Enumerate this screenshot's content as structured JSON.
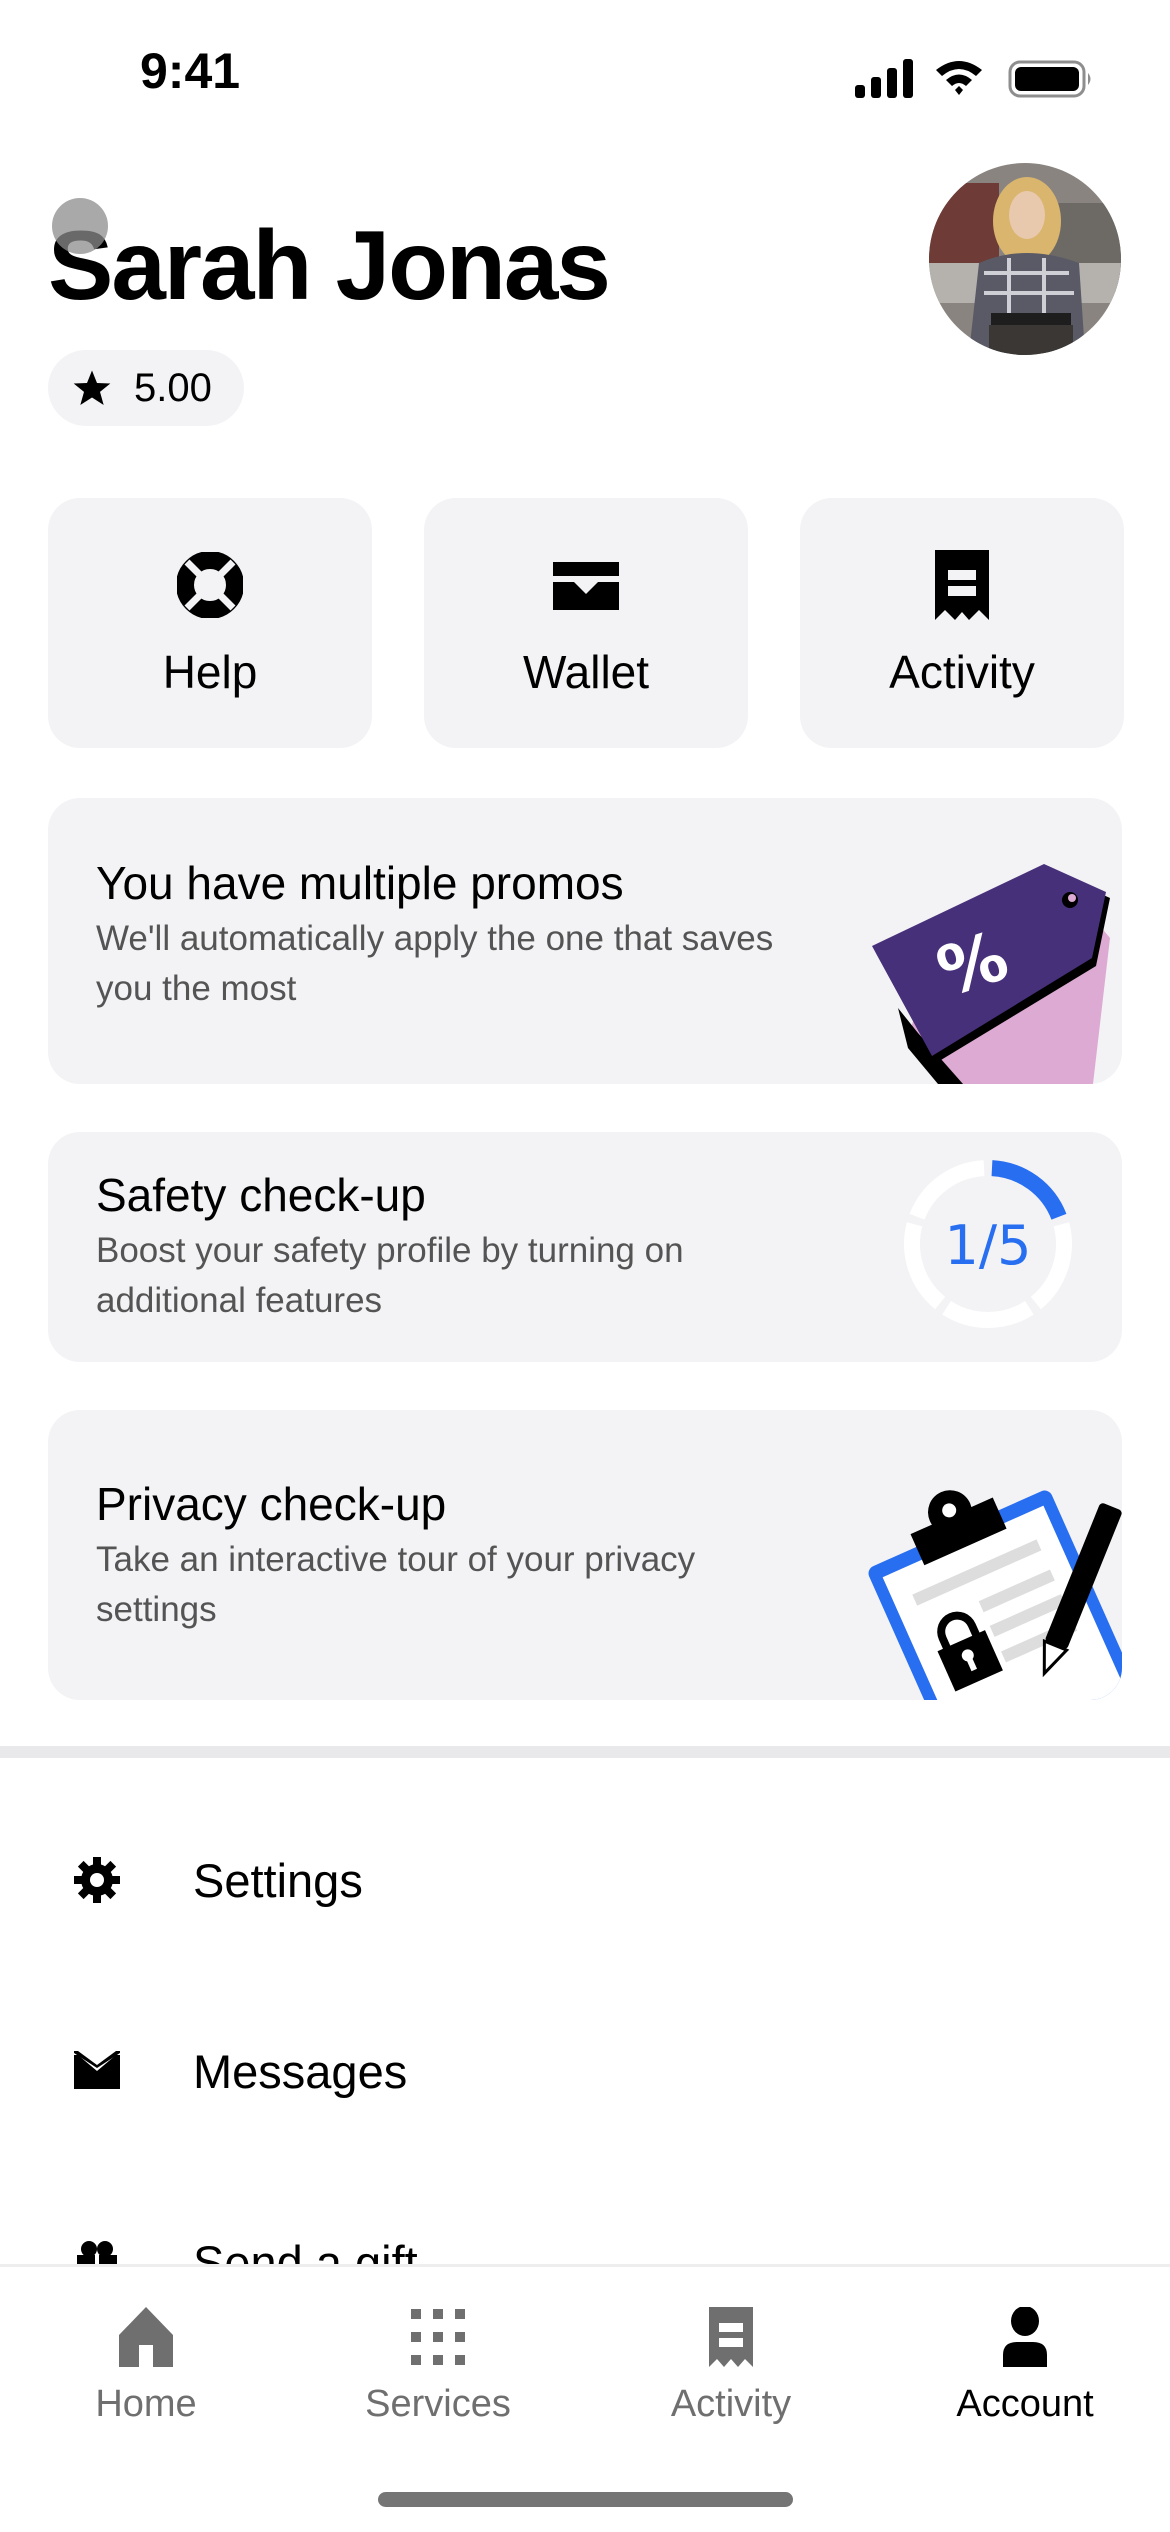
{
  "status_bar": {
    "time": "9:41",
    "icons": [
      "cellular-signal-icon",
      "wifi-icon",
      "battery-icon"
    ]
  },
  "profile": {
    "name": "Sarah Jonas",
    "rating": "5.00",
    "rating_icon": "star-icon",
    "avatar": "profile-photo"
  },
  "quick_actions": [
    {
      "label": "Help",
      "icon": "lifebuoy-icon"
    },
    {
      "label": "Wallet",
      "icon": "wallet-icon"
    },
    {
      "label": "Activity",
      "icon": "receipt-icon"
    }
  ],
  "cards": {
    "promos": {
      "title": "You have multiple promos",
      "subtitle": "We'll automatically apply the one that saves you the most",
      "art": "discount-tag-illustration",
      "art_glyph": "%"
    },
    "safety": {
      "title": "Safety check-up",
      "subtitle": "Boost your safety profile by turning on additional features",
      "progress_label": "1/5",
      "progress_completed": 1,
      "progress_total": 5
    },
    "privacy": {
      "title": "Privacy check-up",
      "subtitle": "Take an interactive tour of your privacy settings",
      "art": "clipboard-lock-illustration"
    }
  },
  "menu": [
    {
      "label": "Settings",
      "icon": "gear-icon"
    },
    {
      "label": "Messages",
      "icon": "envelope-icon"
    },
    {
      "label": "Send a gift",
      "icon": "gift-icon"
    }
  ],
  "tab_bar": {
    "active": "Account",
    "tabs": [
      {
        "label": "Home",
        "icon": "home-icon"
      },
      {
        "label": "Services",
        "icon": "grid-icon"
      },
      {
        "label": "Activity",
        "icon": "receipt-icon"
      },
      {
        "label": "Account",
        "icon": "person-icon"
      }
    ]
  },
  "colors": {
    "card_bg": "#f3f2f5",
    "accent_blue": "#276ef1",
    "promo_purple": "#47307a",
    "promo_pink": "#dcaad2",
    "secondary_text": "#545454",
    "inactive_tab": "#6f6f6f"
  }
}
